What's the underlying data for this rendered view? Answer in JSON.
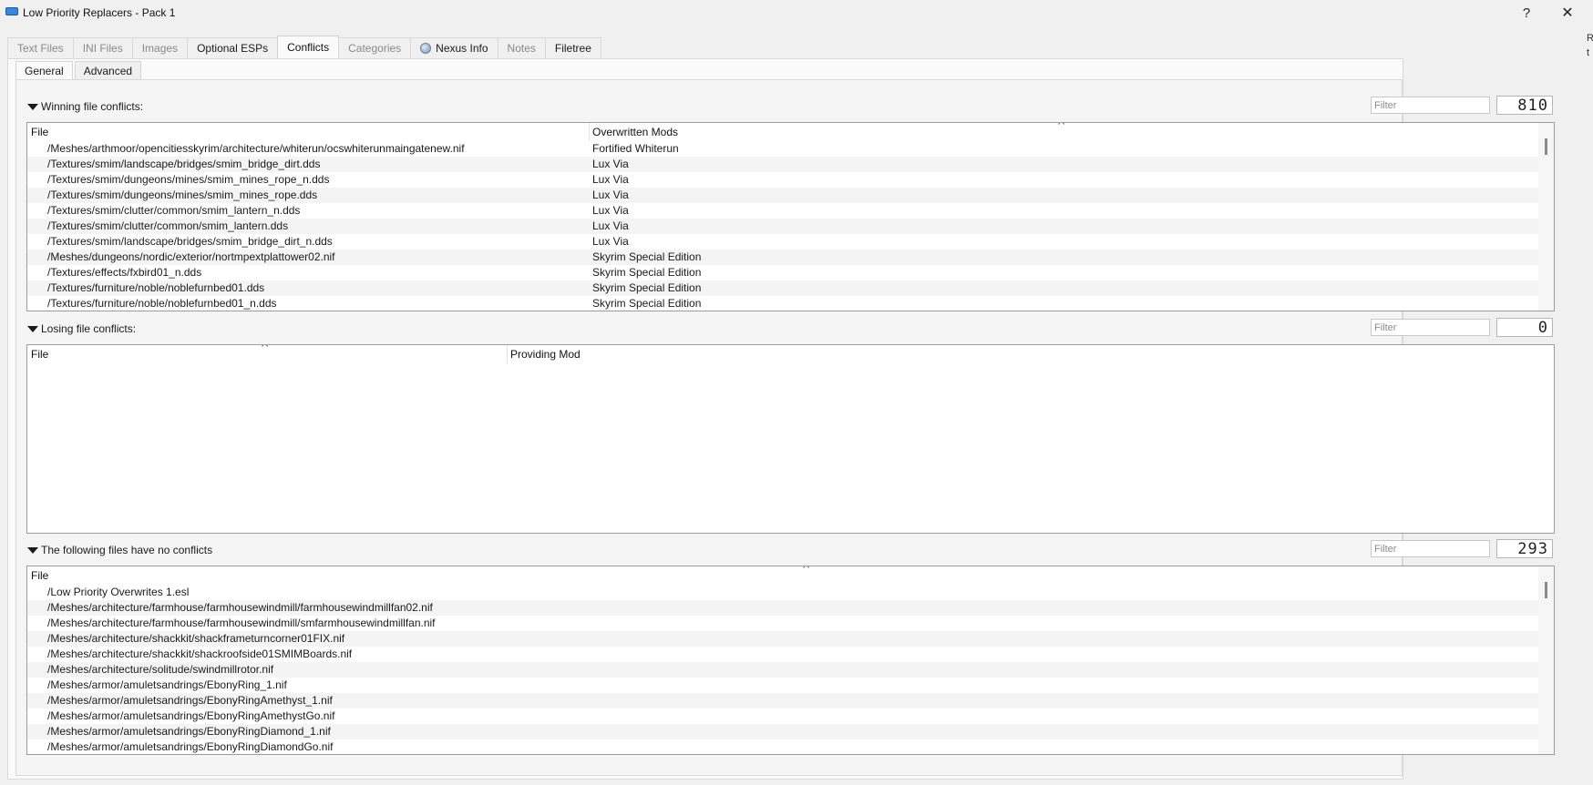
{
  "window": {
    "title": "Low Priority Replacers - Pack 1",
    "help_label": "?",
    "close_label": "✕",
    "edge_fragments": [
      "R",
      "t"
    ]
  },
  "tabs": [
    {
      "label": "Text Files",
      "enabled": false
    },
    {
      "label": "INI Files",
      "enabled": false
    },
    {
      "label": "Images",
      "enabled": false
    },
    {
      "label": "Optional ESPs",
      "enabled": true
    },
    {
      "label": "Conflicts",
      "enabled": true,
      "active": true
    },
    {
      "label": "Categories",
      "enabled": false
    },
    {
      "label": "Nexus Info",
      "enabled": true,
      "icon": "globe-icon"
    },
    {
      "label": "Notes",
      "enabled": false
    },
    {
      "label": "Filetree",
      "enabled": true
    }
  ],
  "subtabs": [
    {
      "label": "General",
      "active": true
    },
    {
      "label": "Advanced",
      "active": false
    }
  ],
  "winning": {
    "header": "Winning file conflicts:",
    "filter_placeholder": "Filter",
    "count": "810",
    "columns": [
      "File",
      "Overwritten Mods"
    ],
    "rows": [
      [
        "/Meshes/arthmoor/opencitiesskyrim/architecture/whiterun/ocswhiterunmaingatenew.nif",
        "Fortified Whiterun"
      ],
      [
        "/Textures/smim/landscape/bridges/smim_bridge_dirt.dds",
        "Lux Via"
      ],
      [
        "/Textures/smim/dungeons/mines/smim_mines_rope_n.dds",
        "Lux Via"
      ],
      [
        "/Textures/smim/dungeons/mines/smim_mines_rope.dds",
        "Lux Via"
      ],
      [
        "/Textures/smim/clutter/common/smim_lantern_n.dds",
        "Lux Via"
      ],
      [
        "/Textures/smim/clutter/common/smim_lantern.dds",
        "Lux Via"
      ],
      [
        "/Textures/smim/landscape/bridges/smim_bridge_dirt_n.dds",
        "Lux Via"
      ],
      [
        "/Meshes/dungeons/nordic/exterior/nortmpextplattower02.nif",
        "Skyrim Special Edition"
      ],
      [
        "/Textures/effects/fxbird01_n.dds",
        "Skyrim Special Edition"
      ],
      [
        "/Textures/furniture/noble/noblefurnbed01.dds",
        "Skyrim Special Edition"
      ],
      [
        "/Textures/furniture/noble/noblefurnbed01_n.dds",
        "Skyrim Special Edition"
      ]
    ]
  },
  "losing": {
    "header": "Losing file conflicts:",
    "filter_placeholder": "Filter",
    "count": "0",
    "columns": [
      "File",
      "Providing Mod"
    ],
    "rows": []
  },
  "noconflict": {
    "header": "The following files have no conflicts",
    "filter_placeholder": "Filter",
    "count": "293",
    "columns": [
      "File"
    ],
    "rows": [
      "/Low Priority Overwrites 1.esl",
      "/Meshes/architecture/farmhouse/farmhousewindmill/farmhousewindmillfan02.nif",
      "/Meshes/architecture/farmhouse/farmhousewindmill/smfarmhousewindmillfan.nif",
      "/Meshes/architecture/shackkit/shackframeturncorner01FIX.nif",
      "/Meshes/architecture/shackkit/shackroofside01SMIMBoards.nif",
      "/Meshes/architecture/solitude/swindmillrotor.nif",
      "/Meshes/armor/amuletsandrings/EbonyRing_1.nif",
      "/Meshes/armor/amuletsandrings/EbonyRingAmethyst_1.nif",
      "/Meshes/armor/amuletsandrings/EbonyRingAmethystGo.nif",
      "/Meshes/armor/amuletsandrings/EbonyRingDiamond_1.nif",
      "/Meshes/armor/amuletsandrings/EbonyRingDiamondGo.nif"
    ]
  }
}
